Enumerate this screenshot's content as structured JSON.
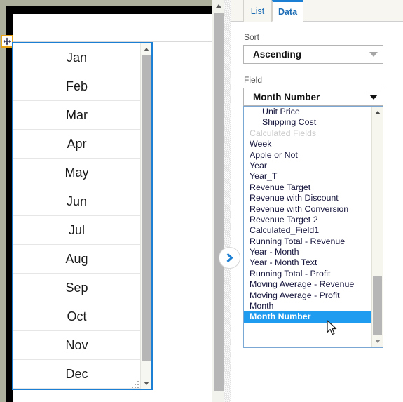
{
  "canvas": {
    "month_widget": {
      "name": "month-list-widget",
      "rows": [
        "Jan",
        "Feb",
        "Mar",
        "Apr",
        "May",
        "Jun",
        "Jul",
        "Aug",
        "Sep",
        "Oct",
        "Nov",
        "Dec"
      ]
    },
    "move_handle_icon": "move-four-arrows-icon",
    "scrollbar_up_icon": "triangle-up-icon",
    "scrollbar_down_icon": "triangle-down-icon",
    "resize_grip_icon": "resize-grip-icon"
  },
  "outer_scroll": {
    "up_icon": "triangle-up-icon"
  },
  "expander": {
    "icon": "chevron-right-icon",
    "accent": "#1b7fd4"
  },
  "right_panel": {
    "tabs": [
      {
        "label": "List",
        "active": false
      },
      {
        "label": "Data",
        "active": true
      }
    ],
    "sort": {
      "label": "Sort",
      "value": "Ascending",
      "arrow_icon": "chevron-down-icon"
    },
    "field": {
      "label": "Field",
      "value": "Month Number",
      "arrow_icon": "chevron-down-icon"
    },
    "dropdown": {
      "selected": "Month Number",
      "items": [
        {
          "label": "Unit Price",
          "type": "indent"
        },
        {
          "label": "Shipping Cost",
          "type": "indent"
        },
        {
          "label": "Calculated Fields",
          "type": "header"
        },
        {
          "label": "Week",
          "type": "item"
        },
        {
          "label": "Apple or Not",
          "type": "item"
        },
        {
          "label": "Year",
          "type": "item"
        },
        {
          "label": "Year_T",
          "type": "item"
        },
        {
          "label": "Revenue Target",
          "type": "item"
        },
        {
          "label": "Revenue with Discount",
          "type": "item"
        },
        {
          "label": "Revenue with Conversion",
          "type": "item"
        },
        {
          "label": "Revenue Target 2",
          "type": "item"
        },
        {
          "label": "Calculated_Field1",
          "type": "item"
        },
        {
          "label": "Running Total - Revenue",
          "type": "item"
        },
        {
          "label": "Year - Month",
          "type": "item"
        },
        {
          "label": "Year - Month Text",
          "type": "item"
        },
        {
          "label": "Running Total - Profit",
          "type": "item"
        },
        {
          "label": "Moving Average - Revenue",
          "type": "item"
        },
        {
          "label": "Moving Average - Profit",
          "type": "item"
        },
        {
          "label": "Month",
          "type": "item"
        },
        {
          "label": "Month Number",
          "type": "selected"
        }
      ],
      "scroll_up_icon": "triangle-up-icon",
      "scroll_down_icon": "triangle-down-icon",
      "highlight_color": "#1f9bf0"
    }
  },
  "cursor": {
    "icon": "mouse-pointer-icon"
  }
}
